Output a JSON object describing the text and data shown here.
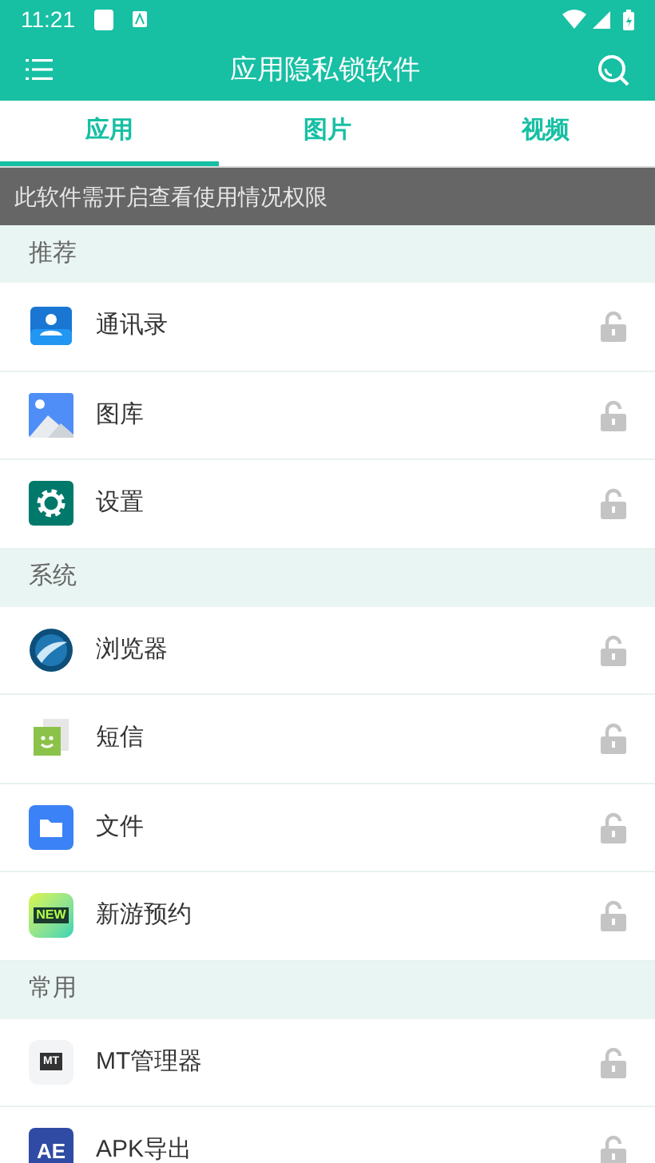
{
  "status_bar": {
    "time": "11:21"
  },
  "app_bar": {
    "title": "应用隐私锁软件"
  },
  "tabs": [
    {
      "label": "应用",
      "selected": true
    },
    {
      "label": "图片",
      "selected": false
    },
    {
      "label": "视频",
      "selected": false
    }
  ],
  "notice": "此软件需开启查看使用情况权限",
  "sections": [
    {
      "title": "推荐",
      "apps": [
        {
          "name": "通讯录",
          "kind": "contacts",
          "locked": false
        },
        {
          "name": "图库",
          "kind": "gallery",
          "locked": false
        },
        {
          "name": "设置",
          "kind": "settings",
          "locked": false
        }
      ]
    },
    {
      "title": "系统",
      "apps": [
        {
          "name": "浏览器",
          "kind": "browser",
          "locked": false
        },
        {
          "name": "短信",
          "kind": "sms",
          "locked": false
        },
        {
          "name": "文件",
          "kind": "files",
          "locked": false
        },
        {
          "name": "新游预约",
          "kind": "newgame",
          "icon_text": "NEW",
          "locked": false
        }
      ]
    },
    {
      "title": "常用",
      "apps": [
        {
          "name": "MT管理器",
          "kind": "mt",
          "icon_text": "MT",
          "locked": false
        },
        {
          "name": "APK导出",
          "kind": "ae",
          "icon_text": "AE",
          "locked": false
        }
      ]
    }
  ]
}
